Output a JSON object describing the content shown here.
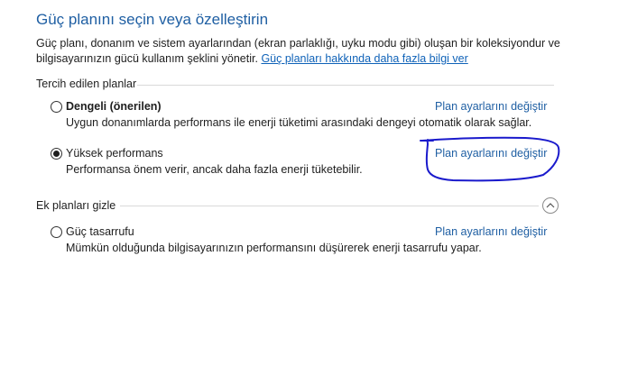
{
  "header": {
    "title": "Güç planını seçin veya özelleştirin",
    "description": "Güç planı, donanım ve sistem ayarlarından (ekran parlaklığı, uyku modu gibi) oluşan bir koleksiyondur ve bilgisayarınızın gücü kullanım şeklini yönetir.",
    "learn_more_link": "Güç planları hakkında daha fazla bilgi ver"
  },
  "preferred_section": {
    "label": "Tercih edilen planlar",
    "plans": [
      {
        "name": "Dengeli (önerilen)",
        "description": "Uygun donanımlarda performans ile enerji tüketimi arasındaki dengeyi otomatik olarak sağlar.",
        "link": "Plan ayarlarını değiştir",
        "selected": false
      },
      {
        "name": "Yüksek performans",
        "description": "Performansa önem verir, ancak daha fazla enerji tüketebilir.",
        "link": "Plan ayarlarını değiştir",
        "selected": true
      }
    ]
  },
  "additional_section": {
    "label": "Ek planları gizle",
    "toggle_icon": "chevron-up-icon",
    "plans": [
      {
        "name": "Güç tasarrufu",
        "description": "Mümkün olduğunda bilgisayarınızın performansını düşürerek enerji tasarrufu yapar.",
        "link": "Plan ayarlarını değiştir",
        "selected": false
      }
    ]
  },
  "annotation": {
    "color": "#1a1acc",
    "shape": "hand-drawn-circle"
  }
}
